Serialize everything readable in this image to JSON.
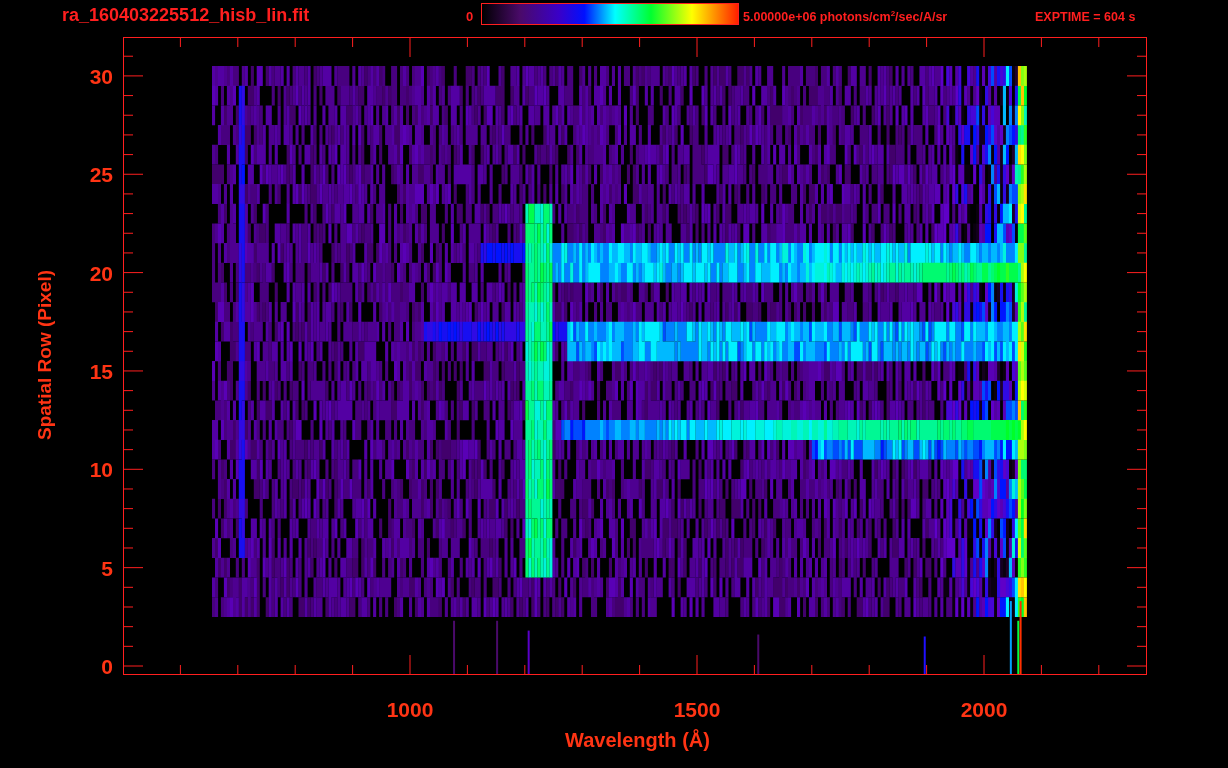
{
  "header": {
    "title": "ra_160403225512_hisb_lin.fit",
    "colorbar": {
      "min_label": "0",
      "max_label": "5.00000e+06 photons/cm$^{2}$/sec/A/sr"
    },
    "exposure": "EXPTIME = 604 s"
  },
  "plot": {
    "xlabel": "Wavelength (Å)",
    "ylabel": "Spatial Row (Pixel)",
    "xticks": [
      "1000",
      "1500",
      "2000"
    ],
    "yticks": [
      "30",
      "25",
      "20",
      "15",
      "10",
      "5",
      "0"
    ]
  }
}
